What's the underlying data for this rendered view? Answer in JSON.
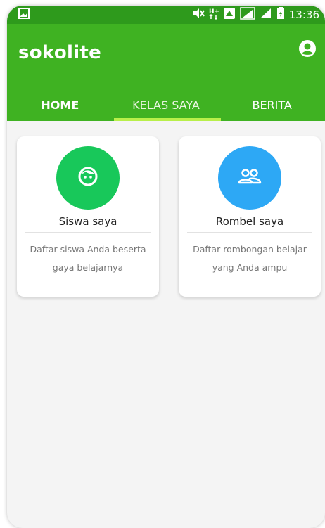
{
  "status_bar": {
    "time": "13:36",
    "icons": [
      "image-notification-icon",
      "mute-icon",
      "data-hplus-icon",
      "app-icon",
      "signal-icon",
      "signal-icon",
      "battery-icon"
    ]
  },
  "app": {
    "title": "sokolite",
    "account_icon": "account-circle-icon"
  },
  "tabs": [
    {
      "label": "HOME",
      "active": false
    },
    {
      "label": "KELAS SAYA",
      "active": true
    },
    {
      "label": "BERITA",
      "active": false
    }
  ],
  "cards": [
    {
      "title": "Siswa saya",
      "description": "Daftar siswa Anda beserta gaya belajarnya",
      "icon": "child-face-icon",
      "color": "#18c85a"
    },
    {
      "title": "Rombel saya",
      "description": "Daftar rombongan belajar yang Anda ampu",
      "icon": "group-icon",
      "color": "#2da8f5"
    }
  ],
  "colors": {
    "primary": "#3fb222",
    "status_bar": "#2e9a1c",
    "tab_indicator": "#b8ef4a"
  }
}
